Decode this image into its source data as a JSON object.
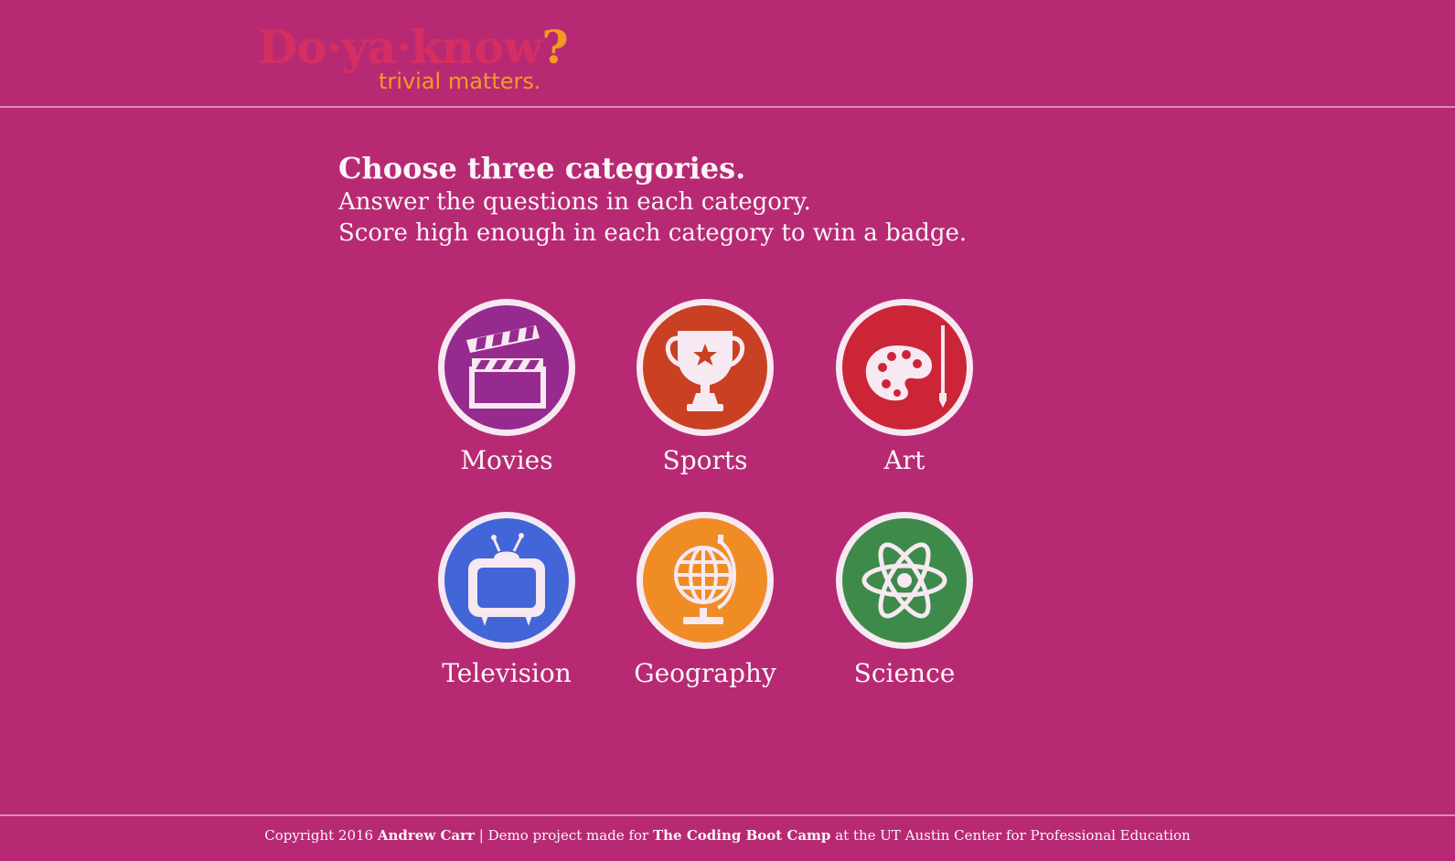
{
  "header": {
    "logo_main": "Do·ya·know",
    "logo_mark": "?",
    "tagline": "trivial matters."
  },
  "intro": {
    "title": "Choose three categories.",
    "line1": "Answer the questions in each category.",
    "line2": "Score high enough in each category to win a badge."
  },
  "categories": [
    {
      "label": "Movies",
      "icon": "clapperboard-icon",
      "color": "#962a8e"
    },
    {
      "label": "Sports",
      "icon": "trophy-icon",
      "color": "#c94122"
    },
    {
      "label": "Art",
      "icon": "palette-icon",
      "color": "#cc2538"
    },
    {
      "label": "Television",
      "icon": "television-icon",
      "color": "#4265d8"
    },
    {
      "label": "Geography",
      "icon": "globe-icon",
      "color": "#f08c26"
    },
    {
      "label": "Science",
      "icon": "atom-icon",
      "color": "#3e8a4b"
    }
  ],
  "footer": {
    "copyright": "Copyright 2016",
    "author": "Andrew Carr",
    "separator": "|",
    "text_before": "Demo project made for",
    "bootcamp": "The Coding Boot Camp",
    "text_after": "at the UT Austin Center for Professional Education"
  },
  "colors": {
    "background": "#b72a73",
    "logo_red": "#d42e63",
    "logo_orange": "#f39a25",
    "badge_ring": "#f7e9f1",
    "text": "#fbf4f8"
  }
}
